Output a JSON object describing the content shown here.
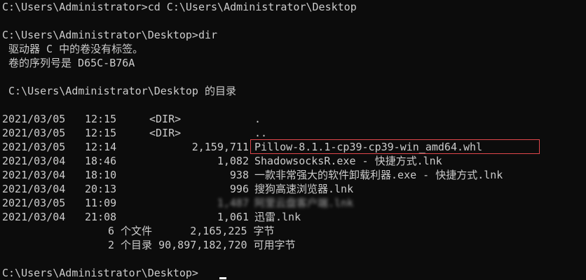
{
  "window": {
    "background": "#0c0c0c",
    "foreground": "#cccccc",
    "highlight_color": "#e0474c"
  },
  "lines": {
    "cmd1": "C:\\Users\\Administrator>cd C:\\Users\\Administrator\\Desktop",
    "cmd2": "C:\\Users\\Administrator\\Desktop>dir",
    "volume_label": " 驱动器 C 中的卷没有标签。",
    "volume_serial": " 卷的序列号是 D65C-B76A",
    "dir_header": " C:\\Users\\Administrator\\Desktop 的目录",
    "prompt_final": "C:\\Users\\Administrator\\Desktop>"
  },
  "entries": [
    {
      "date": "2021/03/05",
      "time": "12:15",
      "type": "<DIR>",
      "size": "",
      "name": "."
    },
    {
      "date": "2021/03/05",
      "time": "12:15",
      "type": "<DIR>",
      "size": "",
      "name": ".."
    },
    {
      "date": "2021/03/05",
      "time": "12:14",
      "type": "",
      "size": "2,159,711",
      "name": "Pillow-8.1.1-cp39-cp39-win_amd64.whl"
    },
    {
      "date": "2021/03/04",
      "time": "18:46",
      "type": "",
      "size": "1,082",
      "name": "ShadowsocksR.exe - 快捷方式.lnk"
    },
    {
      "date": "2021/03/04",
      "time": "18:10",
      "type": "",
      "size": "938",
      "name": "一款非常强大的软件卸载利器.exe - 快捷方式.lnk"
    },
    {
      "date": "2021/03/04",
      "time": "20:13",
      "type": "",
      "size": "996",
      "name": "搜狗高速浏览器.lnk"
    },
    {
      "date": "2021/03/05",
      "time": "11:09",
      "type": "",
      "size": "1,487",
      "name": "阿里云盘客户端.lnk"
    },
    {
      "date": "2021/03/04",
      "time": "21:08",
      "type": "",
      "size": "1,061",
      "name": "迅雷.lnk"
    }
  ],
  "summary": {
    "files": "6 个文件      2,165,225 字节",
    "dirs": "2 个目录 90,897,182,720 可用字节"
  }
}
